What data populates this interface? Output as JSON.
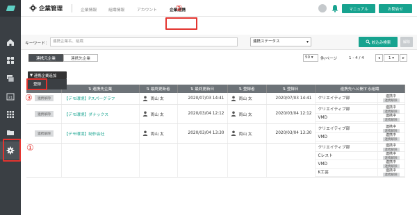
{
  "header": {
    "title": "企業管理",
    "tabs": [
      "企業情報",
      "組織情報",
      "アカウント",
      "企業連携"
    ],
    "manual": "マニュアル",
    "contact": "お問合せ"
  },
  "search": {
    "label": "キーワード：",
    "placeholder": "連携企業名、組織",
    "status": "連携ステータス",
    "narrow": "絞込み検索",
    "clear": "解除"
  },
  "tabs_seg": [
    "連携元企業",
    "連携先企業"
  ],
  "pager": {
    "per_page": "50",
    "per_page_unit": "件/ページ",
    "range": "1 - 4 / 4",
    "page": "1"
  },
  "add_button": "連携企業追加",
  "add_menu_item": "登録",
  "markers": [
    "①",
    "②",
    "③"
  ],
  "table": {
    "headers": [
      "",
      "連携先企業",
      "最終更新者",
      "最終更新日",
      "登録者",
      "登録日",
      "連携先へ公開する組織"
    ],
    "release_label": "連携解除",
    "rows": [
      {
        "company": "【デモ環境】Pスパーグラフ",
        "updater": "両山 太",
        "updated": "2020/07/03 14:41",
        "registrant": "両山 太",
        "registered": "2020/07/03 14:41",
        "orgs": [
          "クリエイティブ部"
        ],
        "pubs": [
          {
            "st": "連携中",
            "tag": "連携解除"
          }
        ]
      },
      {
        "company": "【デモ環境】ダナックス",
        "updater": "両山 太",
        "updated": "2020/03/04 12:12",
        "registrant": "両山 太",
        "registered": "2020/03/04 12:12",
        "orgs": [
          "クリエイティブ部",
          "VMD"
        ],
        "pubs": [
          {
            "st": "連携中",
            "tag": "連携解除"
          },
          {
            "st": "連携中",
            "tag": "連携解除"
          }
        ]
      },
      {
        "company": "【デモ環境】制作会社",
        "updater": "両山 太",
        "updated": "2020/03/04 13:30",
        "registrant": "両山 太",
        "registered": "2020/03/04 13:30",
        "orgs": [
          "クリエイティブ部",
          "VMD"
        ],
        "pubs": [
          {
            "st": "連携中",
            "tag": "連携解除"
          },
          {
            "st": "連携中",
            "tag": "連携解除"
          }
        ]
      },
      {
        "company": "",
        "updater": "",
        "updated": "",
        "registrant": "",
        "registered": "",
        "orgs": [
          "クリエイティブ部",
          "Cレスト",
          "VMD",
          "K工芸"
        ],
        "pubs": [
          {
            "st": "連携中",
            "tag": "連携解除"
          },
          {
            "st": "連携中",
            "tag": "連携解除"
          },
          {
            "st": "連携中",
            "tag": "連携解除"
          },
          {
            "st": "連携中",
            "tag": "連携解除"
          }
        ]
      }
    ]
  },
  "colors": {
    "accent": "#17a38f",
    "sidebar": "#3a3f44",
    "marker": "#e3342f"
  },
  "sidebar_icons": [
    "home-icon",
    "network-icon",
    "layers-icon",
    "calendar-icon",
    "grid-icon",
    "folder-icon",
    "gear-icon"
  ]
}
